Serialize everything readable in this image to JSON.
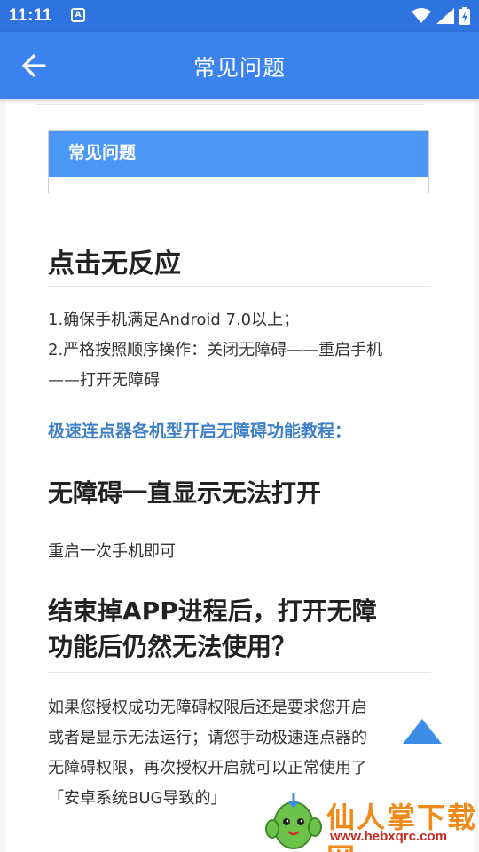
{
  "status_bar": {
    "time": "11:11",
    "notification_letter": "A",
    "icons": [
      "wifi-icon",
      "signal-icon",
      "battery-icon"
    ]
  },
  "app_bar": {
    "title": "常见问题",
    "back_icon": "back-arrow-icon"
  },
  "faq_box": {
    "header": "常见问题"
  },
  "sections": [
    {
      "heading": "点击无反应",
      "lines": [
        "1.确保手机满足Android 7.0以上；",
        "2.严格按照顺序操作：关闭无障碍——重启手机",
        "——打开无障碍"
      ]
    },
    {
      "link": "极速连点器各机型开启无障碍功能教程："
    },
    {
      "heading": "无障碍一直显示无法打开",
      "lines": [
        "重启一次手机即可"
      ]
    },
    {
      "heading_lines": [
        "结束掉APP进程后，打开无障",
        "功能后仍然无法使用？"
      ],
      "lines": [
        "如果您授权成功无障碍权限后还是要求您开启",
        "或者是显示无法运行；请您手动极速连点器的",
        "无障碍权限，再次授权开启就可以正常使用了",
        "「安卓系统BUG导致的」"
      ]
    }
  ],
  "scroll_top_icon": "scroll-to-top-icon",
  "watermark": {
    "name": "仙人掌下载网",
    "url": "www.hebxqrc.com"
  },
  "colors": {
    "status_bar": "#2f73e0",
    "app_bar": "#3b83ee",
    "faq_header": "#4a97f6",
    "link": "#3d7fc8",
    "scroll_button": "#3b8de6"
  }
}
